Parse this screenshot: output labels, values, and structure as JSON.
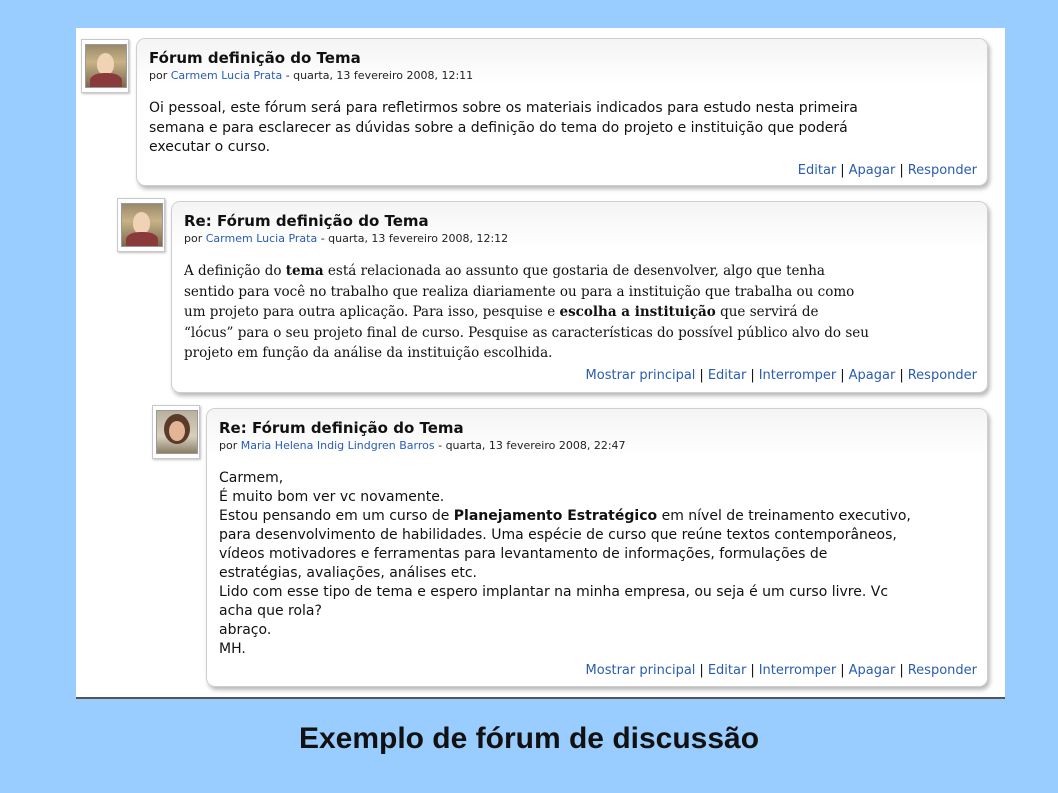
{
  "posts": [
    {
      "title": "Fórum definição do Tema",
      "by": "por",
      "author": "Carmem Lucia Prata",
      "date": "- quarta, 13 fevereiro 2008, 12:11",
      "lines": [
        "Oi pessoal, este fórum será para refletirmos sobre os materiais indicados para estudo nesta primeira",
        "semana e para esclarecer as dúvidas sobre a definição do tema do projeto e instituição que poderá",
        "executar o curso."
      ],
      "actions": [
        "Editar",
        "Apagar",
        "Responder"
      ]
    },
    {
      "title": "Re: Fórum definição do Tema",
      "by": "por",
      "author": "Carmem Lucia Prata",
      "date": "- quarta, 13 fevereiro 2008, 12:12",
      "l1a": "A definição do ",
      "l1b": "tema",
      "l1c": " está relacionada ao assunto que gostaria de desenvolver, algo que tenha",
      "l2": "sentido para você no trabalho que realiza diariamente ou para a instituição que trabalha ou como",
      "l3a": "um projeto para outra aplicação. Para isso, pesquise e ",
      "l3b": "escolha a instituição",
      "l3c": " que servirá de",
      "l4": "“lócus” para o seu projeto final de curso. Pesquise as características do possível público alvo do seu",
      "l5": "projeto em função da análise da instituição escolhida.",
      "actions": [
        "Mostrar principal",
        "Editar",
        "Interromper",
        "Apagar",
        "Responder"
      ]
    },
    {
      "title": "Re: Fórum definição do Tema",
      "by": "por",
      "author": "Maria Helena Indig Lindgren Barros",
      "date": "- quarta, 13 fevereiro 2008, 22:47",
      "l1": "Carmem,",
      "l2": "É muito bom ver vc novamente.",
      "l3a": "Estou pensando em um curso de ",
      "l3b": "Planejamento Estratégico",
      "l3c": " em nível de treinamento executivo,",
      "l4": "para desenvolvimento de habilidades. Uma espécie de curso que reúne textos contemporâneos,",
      "l5": "vídeos motivadores e ferramentas para levantamento de informações, formulações de",
      "l6": "estratégias, avaliações, análises etc.",
      "l7": "Lido com esse tipo de tema e espero implantar na minha empresa, ou seja é um curso livre. Vc",
      "l8": "acha que rola?",
      "l9": "abraço.",
      "l10": "MH.",
      "actions": [
        "Mostrar principal",
        "Editar",
        "Interromper",
        "Apagar",
        "Responder"
      ]
    }
  ],
  "caption": "Exemplo de fórum de discussão"
}
